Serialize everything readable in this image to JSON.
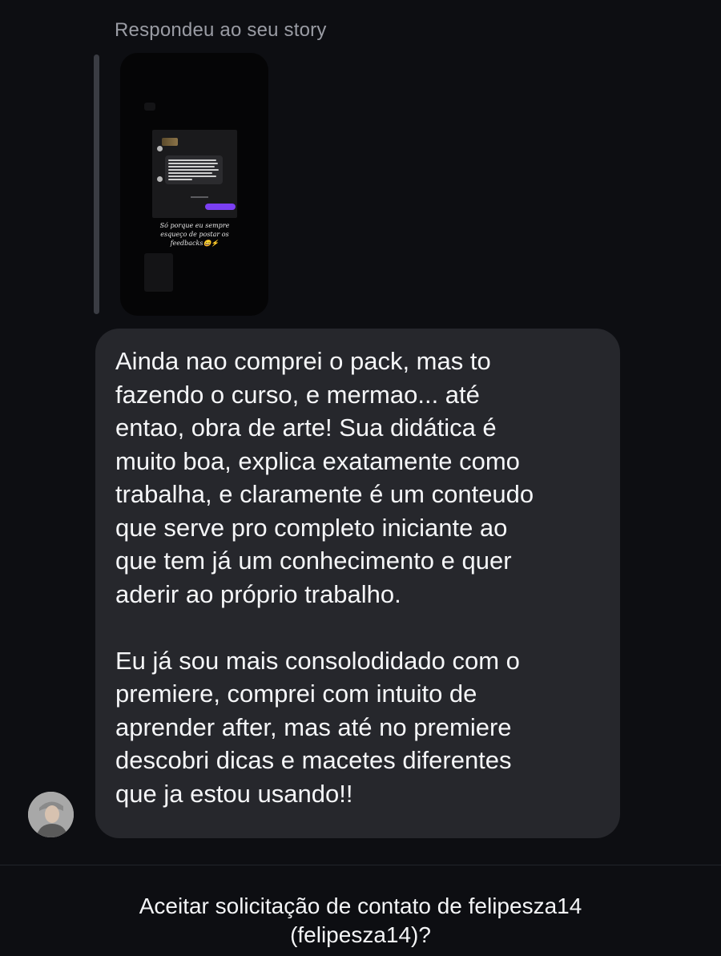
{
  "reply": {
    "label": "Respondeu ao seu story"
  },
  "story": {
    "caption_line1": "Só porque eu sempre",
    "caption_line2": "esqueço de postar os",
    "caption_line3": "feedbacks😄⚡",
    "icon": "story-thumbnail"
  },
  "message": {
    "paragraph1": "Ainda nao comprei o pack, mas to\nfazendo o curso, e mermao... até\nentao, obra de arte! Sua didática é\nmuito boa, explica exatamente como\ntrabalha, e claramente é um conteudo\nque serve pro completo iniciante ao\nque tem já um conhecimento e quer\naderir ao próprio trabalho.",
    "paragraph2": "Eu já sou mais consolodidado com o\npremiere, comprei com intuito de\naprender after, mas até no premiere\ndescobri dicas e macetes diferentes\nque ja estou usando!!"
  },
  "sender": {
    "avatar_icon": "user-avatar"
  },
  "request": {
    "line1": "Aceitar solicitação de contato de felipesza14",
    "line2": "(felipesza14)?"
  },
  "colors": {
    "background": "#0d0e12",
    "bubble": "#26272c",
    "muted_text": "#9a9ca4",
    "accent_purple": "#7b3ff2"
  }
}
